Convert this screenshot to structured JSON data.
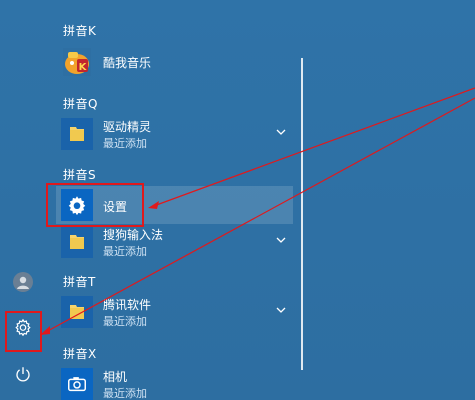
{
  "groups": [
    {
      "letter": "拼音K"
    },
    {
      "letter": "拼音Q"
    },
    {
      "letter": "拼音S"
    },
    {
      "letter": "拼音T"
    },
    {
      "letter": "拼音X"
    }
  ],
  "apps": {
    "kuwo": {
      "name": "酷我音乐",
      "icon": "kuwo-music-icon"
    },
    "qudong": {
      "name": "驱动精灵",
      "subtitle": "最近添加",
      "icon": "folder-icon"
    },
    "settings": {
      "name": "设置",
      "icon": "gear-icon"
    },
    "sougou": {
      "name": "搜狗输入法",
      "subtitle": "最近添加",
      "icon": "folder-icon"
    },
    "tencent": {
      "name": "腾讯软件",
      "subtitle": "最近添加",
      "icon": "folder-icon"
    },
    "camera": {
      "name": "相机",
      "subtitle": "最近添加",
      "icon": "camera-icon"
    }
  },
  "rail": {
    "user_icon": "user-avatar-icon",
    "settings_icon": "gear-icon",
    "power_icon": "power-icon"
  },
  "colors": {
    "background": "#2e6fa3",
    "tile_blue": "#0a66c2",
    "folder_yellow": "#f6d36b",
    "annotation_red": "#e0191c"
  }
}
